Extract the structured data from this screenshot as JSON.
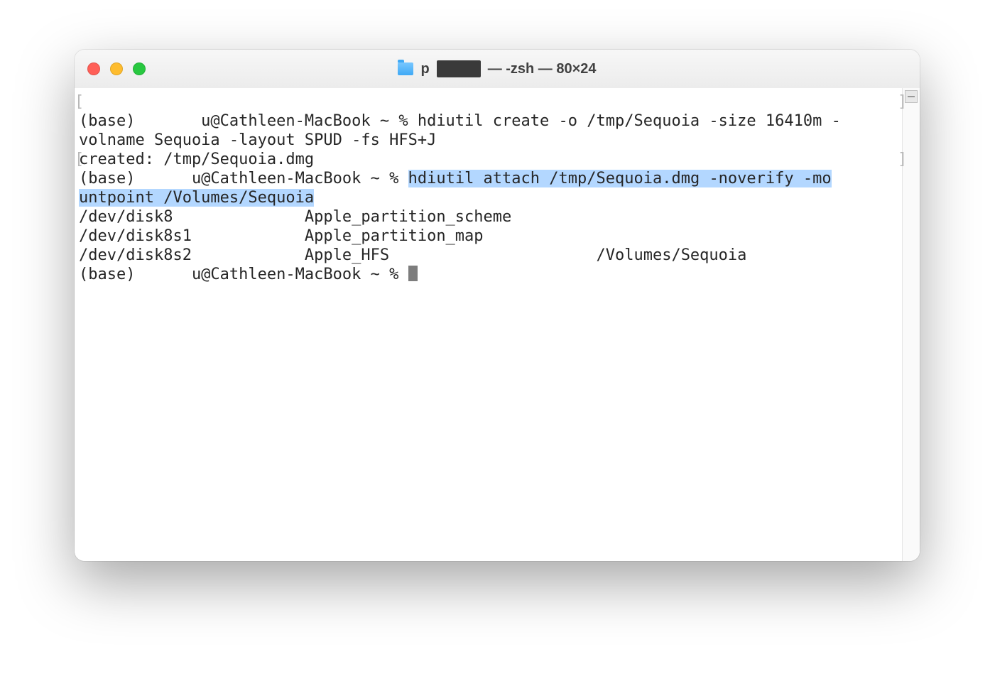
{
  "window": {
    "title_prefix": "p",
    "title_suffix": " — -zsh — 80×24"
  },
  "term": {
    "l1a": "(base)       u@Cathleen-MacBook ~ % hdiutil create -o /tmp/Sequoia -size 16410m -",
    "l2": "volname Sequoia -layout SPUD -fs HFS+J",
    "l3": "created: /tmp/Sequoia.dmg",
    "l4a": "(base)      u@Cathleen-MacBook ~ % ",
    "l4b": "hdiutil attach /tmp/Sequoia.dmg -noverify -mo",
    "l5": "untpoint /Volumes/Sequoia",
    "l6": "/dev/disk8              Apple_partition_scheme",
    "l7": "/dev/disk8s1            Apple_partition_map",
    "l8": "/dev/disk8s2            Apple_HFS                      /Volumes/Sequoia",
    "l9": "(base)      u@Cathleen-MacBook ~ % "
  }
}
